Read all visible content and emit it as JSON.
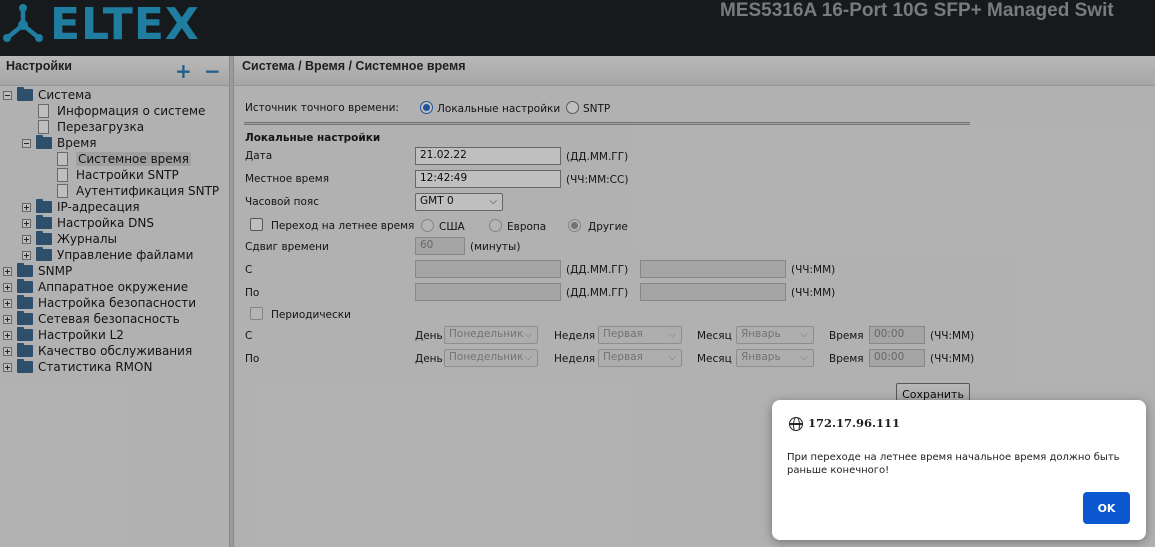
{
  "header": {
    "logo_text": "ELTEX",
    "device_title": "MES5316A 16-Port 10G SFP+ Managed Swit"
  },
  "sidebar": {
    "title": "Настройки",
    "expand_all": "+",
    "collapse_all": "−",
    "tree": {
      "system": "Система",
      "system_info": "Информация о системе",
      "reboot": "Перезагрузка",
      "time": "Время",
      "system_time": "Системное время",
      "sntp_settings": "Настройки SNTP",
      "sntp_auth": "Аутентификация SNTP",
      "ip_addressing": "IP-адресация",
      "dns_settings": "Настройка DNS",
      "logs": "Журналы",
      "file_management": "Управление файлами",
      "snmp": "SNMP",
      "hardware_environment": "Аппаратное окружение",
      "security_settings": "Настройка безопасности",
      "network_security": "Сетевая безопасность",
      "l2_settings": "Настройки L2",
      "qos": "Качество обслуживания",
      "rmon_stats": "Статистика RMON"
    }
  },
  "main": {
    "breadcrumb": "Система / Время / Системное время",
    "source_label": "Источник точного времени:",
    "source_local": "Локальные настройки",
    "source_sntp": "SNTP",
    "section_local": "Локальные настройки",
    "date_label": "Дата",
    "date_value": "21.02.22",
    "date_hint": "(ДД.ММ.ГГ)",
    "local_time_label": "Местное время",
    "local_time_value": "12:42:49",
    "local_time_hint": "(ЧЧ:ММ:СС)",
    "timezone_label": "Часовой пояс",
    "timezone_value": "GMT 0",
    "dst_label": "Переход на летнее время",
    "dst_usa": "США",
    "dst_europe": "Европа",
    "dst_other": "Другие",
    "offset_label": "Сдвиг времени",
    "offset_value": "60",
    "offset_unit": "(минуты)",
    "from_label": "С",
    "to_label": "По",
    "date_hint2": "(ДД.ММ.ГГ)",
    "time_hint_hm": "(ЧЧ:ММ)",
    "periodic_label": "Периодически",
    "periodic_from": "С",
    "periodic_to": "По",
    "day_label": "День",
    "day_value": "Понедельник",
    "week_label": "Неделя",
    "week_value": "Первая",
    "month_label": "Месяц",
    "month_value": "Январь",
    "time_label": "Время",
    "time_value": "00:00",
    "save_label": "Сохранить"
  },
  "dialog": {
    "origin": "172.17.96.111",
    "message": "При переходе на летнее время начальное время должно быть раньше конечного!",
    "ok_label": "OK"
  }
}
